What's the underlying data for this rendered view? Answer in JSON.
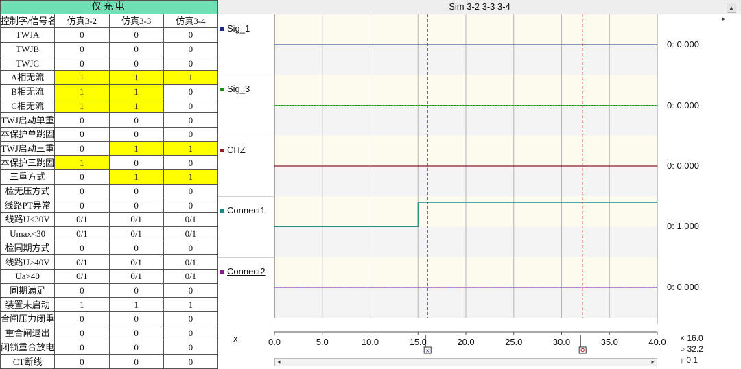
{
  "table": {
    "title": "仅充电",
    "headers": [
      "控制字/信号名",
      "仿真3-2",
      "仿真3-3",
      "仿真3-4"
    ],
    "rows": [
      {
        "name": "TWJA",
        "values": [
          "0",
          "0",
          "0"
        ],
        "hl": [
          false,
          false,
          false
        ]
      },
      {
        "name": "TWJB",
        "values": [
          "0",
          "0",
          "0"
        ],
        "hl": [
          false,
          false,
          false
        ]
      },
      {
        "name": "TWJC",
        "values": [
          "0",
          "0",
          "0"
        ],
        "hl": [
          false,
          false,
          false
        ]
      },
      {
        "name": "A相无流",
        "values": [
          "1",
          "1",
          "1"
        ],
        "hl": [
          true,
          true,
          true
        ]
      },
      {
        "name": "B相无流",
        "values": [
          "1",
          "1",
          "0"
        ],
        "hl": [
          true,
          true,
          false
        ]
      },
      {
        "name": "C相无流",
        "values": [
          "1",
          "1",
          "0"
        ],
        "hl": [
          true,
          true,
          false
        ]
      },
      {
        "name": "TWJ启动单重",
        "values": [
          "0",
          "0",
          "0"
        ],
        "hl": [
          false,
          false,
          false
        ]
      },
      {
        "name": "本保护单跳固定",
        "values": [
          "0",
          "0",
          "0"
        ],
        "hl": [
          false,
          false,
          false
        ]
      },
      {
        "name": "TWJ启动三重",
        "values": [
          "0",
          "1",
          "1"
        ],
        "hl": [
          false,
          true,
          true
        ]
      },
      {
        "name": "本保护三跳固定",
        "values": [
          "1",
          "0",
          "0"
        ],
        "hl": [
          true,
          false,
          false
        ]
      },
      {
        "name": "三重方式",
        "values": [
          "0",
          "1",
          "1"
        ],
        "hl": [
          false,
          true,
          true
        ]
      },
      {
        "name": "检无压方式",
        "values": [
          "0",
          "0",
          "0"
        ],
        "hl": [
          false,
          false,
          false
        ]
      },
      {
        "name": "线路PT异常",
        "values": [
          "0",
          "0",
          "0"
        ],
        "hl": [
          false,
          false,
          false
        ]
      },
      {
        "name": "线路U<30V",
        "values": [
          "0/1",
          "0/1",
          "0/1"
        ],
        "hl": [
          false,
          false,
          false
        ]
      },
      {
        "name": "Umax<30",
        "values": [
          "0/1",
          "0/1",
          "0/1"
        ],
        "hl": [
          false,
          false,
          false
        ]
      },
      {
        "name": "检同期方式",
        "values": [
          "0",
          "0",
          "0"
        ],
        "hl": [
          false,
          false,
          false
        ]
      },
      {
        "name": "线路U>40V",
        "values": [
          "0/1",
          "0/1",
          "0/1"
        ],
        "hl": [
          false,
          false,
          false
        ]
      },
      {
        "name": "Ua>40",
        "values": [
          "0/1",
          "0/1",
          "0/1"
        ],
        "hl": [
          false,
          false,
          false
        ]
      },
      {
        "name": "同期满足",
        "values": [
          "0",
          "0",
          "0"
        ],
        "hl": [
          false,
          false,
          false
        ]
      },
      {
        "name": "装置未启动",
        "values": [
          "1",
          "1",
          "1"
        ],
        "hl": [
          false,
          false,
          false
        ]
      },
      {
        "name": "合闸压力闭重",
        "values": [
          "0",
          "0",
          "0"
        ],
        "hl": [
          false,
          false,
          false
        ]
      },
      {
        "name": "重合闸退出",
        "values": [
          "0",
          "0",
          "0"
        ],
        "hl": [
          false,
          false,
          false
        ]
      },
      {
        "name": "闭锁重合放电",
        "values": [
          "0",
          "0",
          "0"
        ],
        "hl": [
          false,
          false,
          false
        ]
      },
      {
        "name": "CT断线",
        "values": [
          "0",
          "0",
          "0"
        ],
        "hl": [
          false,
          false,
          false
        ]
      }
    ],
    "highlight_color": "#ffff00",
    "title_color": "#6fe0b4"
  },
  "sim_window": {
    "title": "Sim 3-2 3-3 3-4",
    "signals": [
      {
        "name": "Sig_1",
        "value_label": "0: 0.000",
        "color": "#1f2a8a"
      },
      {
        "name": "Sig_3",
        "value_label": "0: 0.000",
        "color": "#1a8a1a"
      },
      {
        "name": "CHZ",
        "value_label": "0: 0.000",
        "color": "#8a1f2a"
      },
      {
        "name": "Connect1",
        "value_label": "0: 1.000",
        "color": "#1f8a8a"
      },
      {
        "name": "Connect2",
        "value_label": "0: 0.000",
        "color": "#8a1f8a"
      }
    ],
    "x_axis_label": "x",
    "x_ticks": [
      "0.0",
      "5.0",
      "10.0",
      "15.0",
      "20.0",
      "25.0",
      "30.0",
      "35.0",
      "40.0"
    ],
    "x_range": [
      0,
      40
    ],
    "cursor1_x": 16.0,
    "cursor2_x": 32.2,
    "readouts": {
      "cursor1": "16.0",
      "cursor2": "32.2",
      "delta": "0.1"
    },
    "connect1_step_x": 15.0
  }
}
